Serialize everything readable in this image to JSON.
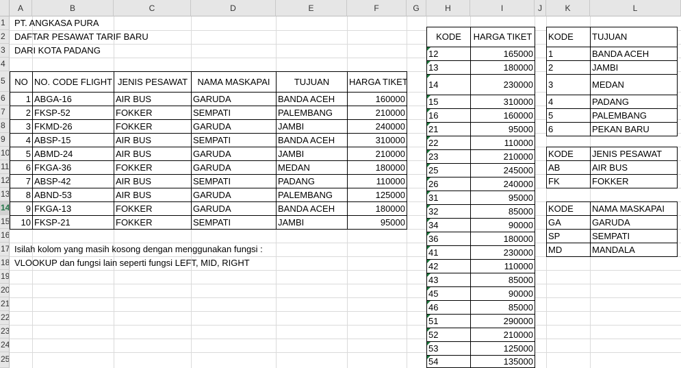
{
  "columns": [
    "A",
    "B",
    "C",
    "D",
    "E",
    "F",
    "G",
    "H",
    "I",
    "J",
    "K",
    "L"
  ],
  "rows": [
    "1",
    "2",
    "3",
    "4",
    "5",
    "6",
    "7",
    "8",
    "9",
    "10",
    "11",
    "12",
    "13",
    "14",
    "15",
    "16",
    "17",
    "18",
    "19",
    "20",
    "21",
    "22",
    "23",
    "24",
    "25"
  ],
  "selected_row": "14",
  "main": {
    "company": "PT. ANGKASA PURA",
    "title": "DAFTAR PESAWAT TARIF BARU",
    "subtitle": "DARI KOTA PADANG",
    "headers": [
      "NO",
      "NO. CODE FLIGHT",
      "JENIS PESAWAT",
      "NAMA MASKAPAI",
      "TUJUAN",
      "HARGA TIKET"
    ],
    "rows": [
      [
        "1",
        "ABGA-16",
        "AIR BUS",
        "GARUDA",
        "BANDA ACEH",
        "160000"
      ],
      [
        "2",
        "FKSP-52",
        "FOKKER",
        "SEMPATI",
        "PALEMBANG",
        "210000"
      ],
      [
        "3",
        "FKMD-26",
        "FOKKER",
        "GARUDA",
        "JAMBI",
        "240000"
      ],
      [
        "4",
        "ABSP-15",
        "AIR BUS",
        "SEMPATI",
        "BANDA ACEH",
        "310000"
      ],
      [
        "5",
        "ABMD-24",
        "AIR BUS",
        "GARUDA",
        "JAMBI",
        "210000"
      ],
      [
        "6",
        "FKGA-36",
        "FOKKER",
        "GARUDA",
        "MEDAN",
        "180000"
      ],
      [
        "7",
        "ABSP-42",
        "AIR BUS",
        "SEMPATI",
        "PADANG",
        "110000"
      ],
      [
        "8",
        "ABND-53",
        "AIR BUS",
        "GARUDA",
        "PALEMBANG",
        "125000"
      ],
      [
        "9",
        "FKGA-13",
        "FOKKER",
        "GARUDA",
        "BANDA ACEH",
        "180000"
      ],
      [
        "10",
        "FKSP-21",
        "FOKKER",
        "SEMPATI",
        "JAMBI",
        "95000"
      ]
    ],
    "instruction1": "Isilah kolom yang masih kosong dengan menggunakan fungsi :",
    "instruction2": "VLOOKUP dan fungsi lain seperti fungsi LEFT, MID, RIGHT"
  },
  "price_table": {
    "headers": [
      "KODE",
      "HARGA TIKET"
    ],
    "rows": [
      [
        "12",
        "165000"
      ],
      [
        "13",
        "180000"
      ],
      [
        "14",
        "230000"
      ],
      [
        "15",
        "310000"
      ],
      [
        "16",
        "160000"
      ],
      [
        "21",
        "95000"
      ],
      [
        "22",
        "110000"
      ],
      [
        "23",
        "210000"
      ],
      [
        "25",
        "245000"
      ],
      [
        "26",
        "240000"
      ],
      [
        "31",
        "95000"
      ],
      [
        "32",
        "85000"
      ],
      [
        "34",
        "90000"
      ],
      [
        "36",
        "180000"
      ],
      [
        "41",
        "230000"
      ],
      [
        "42",
        "110000"
      ],
      [
        "43",
        "85000"
      ],
      [
        "45",
        "90000"
      ],
      [
        "46",
        "85000"
      ],
      [
        "51",
        "290000"
      ],
      [
        "52",
        "210000"
      ],
      [
        "53",
        "125000"
      ],
      [
        "54",
        "135000"
      ]
    ]
  },
  "dest_table": {
    "headers": [
      "KODE",
      "TUJUAN"
    ],
    "rows": [
      [
        "1",
        "BANDA ACEH"
      ],
      [
        "2",
        "JAMBI"
      ],
      [
        "3",
        "MEDAN"
      ],
      [
        "4",
        "PADANG"
      ],
      [
        "5",
        "PALEMBANG"
      ],
      [
        "6",
        "PEKAN BARU"
      ]
    ]
  },
  "plane_table": {
    "headers": [
      "KODE",
      "JENIS PESAWAT"
    ],
    "rows": [
      [
        "AB",
        "AIR BUS"
      ],
      [
        "FK",
        "FOKKER"
      ]
    ]
  },
  "airline_table": {
    "headers": [
      "KODE",
      "NAMA MASKAPAI"
    ],
    "rows": [
      [
        "GA",
        "GARUDA"
      ],
      [
        "SP",
        "SEMPATI"
      ],
      [
        "MD",
        "MANDALA"
      ]
    ]
  },
  "colors": {
    "header_bg": "#e6e6e6",
    "gridline": "#dadada",
    "selected": "#217346",
    "comment_marker": "#1e7b3e"
  }
}
